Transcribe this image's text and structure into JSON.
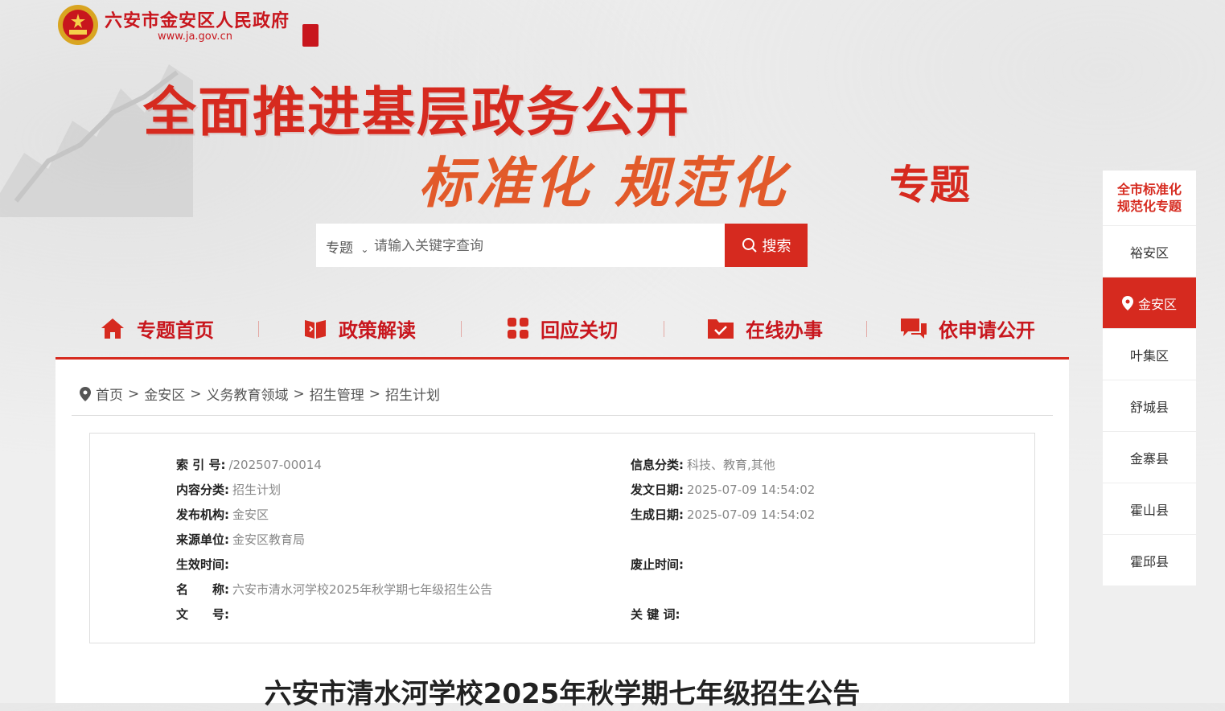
{
  "header": {
    "site_title": "六安市金安区人民政府",
    "site_url": "www.ja.gov.cn",
    "banner_main": "全面推进基层政务公开",
    "banner_sub": "标准化 规范化",
    "banner_tag": "专题"
  },
  "search": {
    "type_label": "专题",
    "placeholder": "请输入关键字查询",
    "button_label": "搜索"
  },
  "nav": {
    "items": [
      {
        "label": "专题首页",
        "icon": "home-icon"
      },
      {
        "label": "政策解读",
        "icon": "book-icon"
      },
      {
        "label": "回应关切",
        "icon": "grid-icon"
      },
      {
        "label": "在线办事",
        "icon": "folder-check-icon"
      },
      {
        "label": "依申请公开",
        "icon": "chat-icon"
      }
    ]
  },
  "breadcrumb": [
    "首页",
    "金安区",
    "义务教育领域",
    "招生管理",
    "招生计划"
  ],
  "meta": {
    "index_label": "索 引 号:",
    "index_value": "/202507-00014",
    "category_label": "信息分类:",
    "category_value": "科技、教育,其他",
    "content_type_label": "内容分类:",
    "content_type_value": "招生计划",
    "publish_date_label": "发文日期:",
    "publish_date_value": "2025-07-09 14:54:02",
    "org_label": "发布机构:",
    "org_value": "金安区",
    "gen_date_label": "生成日期:",
    "gen_date_value": "2025-07-09 14:54:02",
    "source_label": "来源单位:",
    "source_value": "金安区教育局",
    "effective_label": "生效时间:",
    "effective_value": "",
    "expire_label": "废止时间:",
    "expire_value": "",
    "name_label": "名　　称:",
    "name_value": "六安市清水河学校2025年秋学期七年级招生公告",
    "docno_label": "文　　号:",
    "docno_value": "",
    "keywords_label": "关 键 词:",
    "keywords_value": ""
  },
  "document_title": "六安市清水河学校2025年秋学期七年级招生公告",
  "sidebar": {
    "head": "全市标准化规范化专题",
    "items": [
      "裕安区",
      "金安区",
      "叶集区",
      "舒城县",
      "金寨县",
      "霍山县",
      "霍邱县"
    ],
    "active_index": 1
  },
  "colors": {
    "brand_red": "#d62a1f",
    "title_red": "#c8161d"
  }
}
